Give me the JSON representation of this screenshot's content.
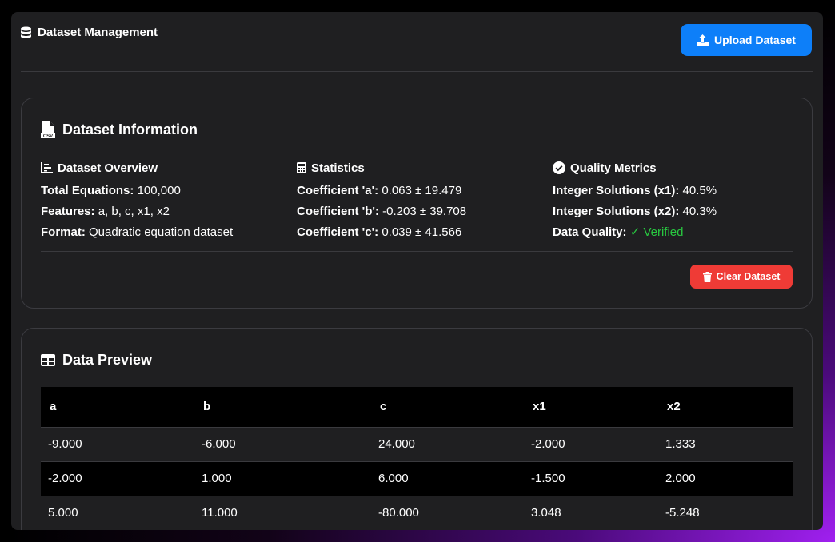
{
  "header": {
    "title": "Dataset Management",
    "upload_label": "Upload Dataset"
  },
  "info": {
    "title": "Dataset Information",
    "overview": {
      "heading": "Dataset Overview",
      "rows": [
        {
          "label": "Total Equations:",
          "value": "100,000"
        },
        {
          "label": "Features:",
          "value": "a, b, c, x1, x2"
        },
        {
          "label": "Format:",
          "value": "Quadratic equation dataset"
        }
      ]
    },
    "statistics": {
      "heading": "Statistics",
      "rows": [
        {
          "label": "Coefficient 'a':",
          "value": "0.063 ± 19.479"
        },
        {
          "label": "Coefficient 'b':",
          "value": "-0.203 ± 39.708"
        },
        {
          "label": "Coefficient 'c':",
          "value": "0.039 ± 41.566"
        }
      ]
    },
    "quality": {
      "heading": "Quality Metrics",
      "rows": [
        {
          "label": "Integer Solutions (x1):",
          "value": "40.5%"
        },
        {
          "label": "Integer Solutions (x2):",
          "value": "40.3%"
        },
        {
          "label": "Data Quality:",
          "value": "✓ Verified"
        }
      ]
    },
    "clear_label": "Clear Dataset"
  },
  "preview": {
    "title": "Data Preview",
    "columns": [
      "a",
      "b",
      "c",
      "x1",
      "x2"
    ],
    "rows": [
      [
        "-9.000",
        "-6.000",
        "24.000",
        "-2.000",
        "1.333"
      ],
      [
        "-2.000",
        "1.000",
        "6.000",
        "-1.500",
        "2.000"
      ],
      [
        "5.000",
        "11.000",
        "-80.000",
        "3.048",
        "-5.248"
      ]
    ]
  },
  "colors": {
    "primary": "#0d7ff9",
    "danger": "#ef3b36",
    "success": "#28c840",
    "panel": "#1f1f21"
  },
  "icons": {
    "header": "database-icon",
    "upload": "upload-icon",
    "info": "file-csv-icon",
    "overview": "chart-list-icon",
    "statistics": "calculator-icon",
    "quality": "check-circle-icon",
    "clear": "trash-icon",
    "preview": "table-icon"
  }
}
